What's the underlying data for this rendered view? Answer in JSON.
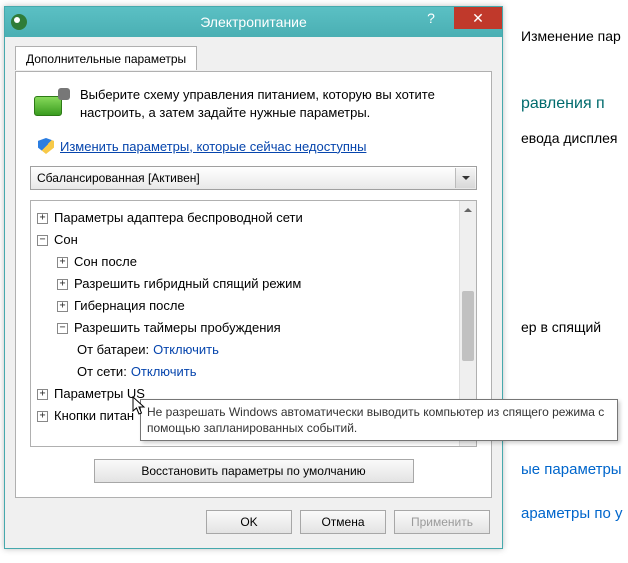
{
  "dialog": {
    "title": "Электропитание",
    "help_glyph": "?",
    "close_glyph": "✕",
    "tab_label": "Дополнительные параметры",
    "intro_text": "Выберите схему управления питанием, которую вы хотите настроить, а затем задайте нужные параметры.",
    "admin_link": "Изменить параметры, которые сейчас недоступны",
    "plan_combo": "Сбалансированная [Активен]",
    "tree": {
      "wireless": "Параметры адаптера беспроводной сети",
      "sleep": "Сон",
      "sleep_after": "Сон после",
      "hybrid": "Разрешить гибридный спящий режим",
      "hibernate_after": "Гибернация после",
      "wake_timers": "Разрешить таймеры пробуждения",
      "on_battery_label": "От батареи:",
      "on_battery_value": "Отключить",
      "on_ac_label": "От сети:",
      "on_ac_value": "Отключить",
      "usb": "Параметры US",
      "power_buttons": "Кнопки питан"
    },
    "restore_defaults": "Восстановить параметры по умолчанию",
    "ok": "OK",
    "cancel": "Отмена",
    "apply": "Применить"
  },
  "tooltip": "Не разрешать Windows автоматически выводить компьютер из спящего режима с помощью запланированных событий.",
  "bg": {
    "l1": "Изменение пар",
    "l2": "равления п",
    "l3": "евода дисплея",
    "l4": "ер в спящий",
    "l5": "ые параметры",
    "l6": "араметры по у"
  }
}
